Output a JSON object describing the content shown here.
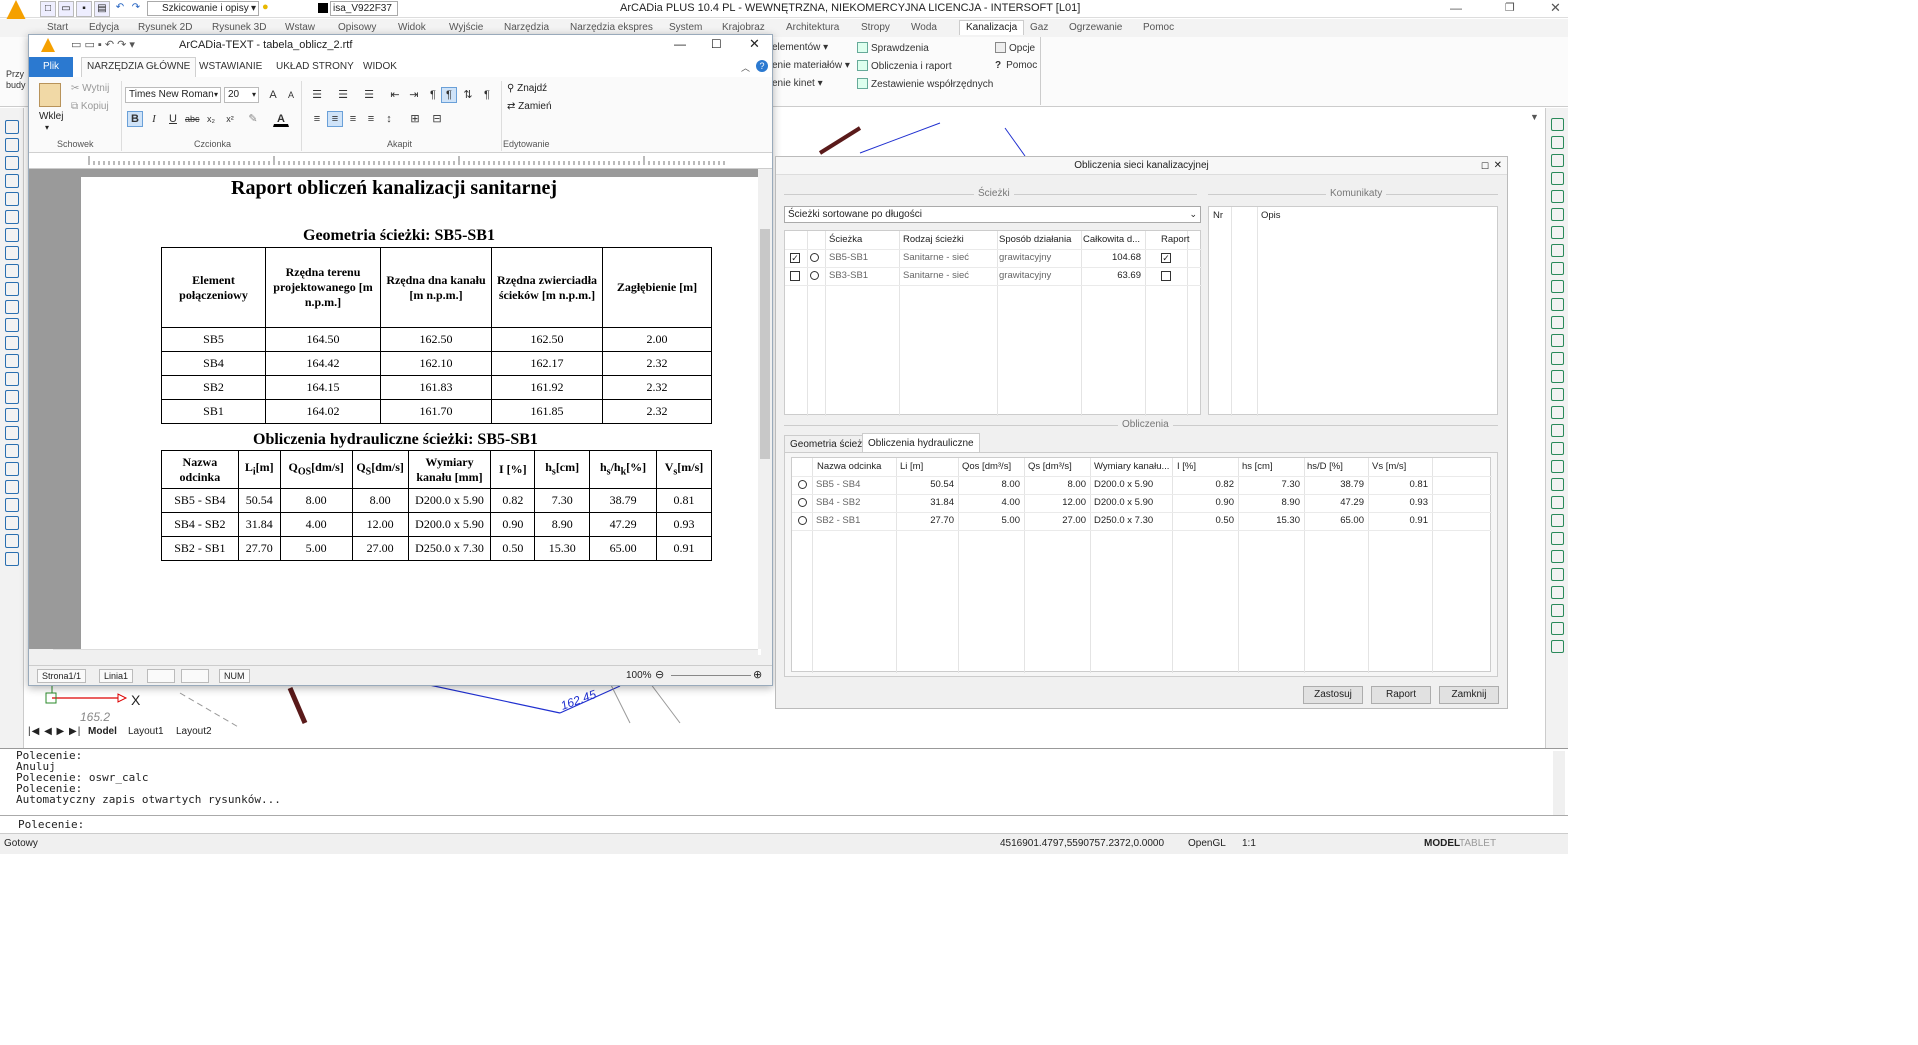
{
  "app": {
    "title": "ArCADia PLUS 10.4 PL - WEWNĘTRZNA, NIEKOMERCYJNA LICENCJA - INTERSOFT [L01]",
    "workspace": "Szkicowanie i opisy",
    "layer": "isa_V922F37"
  },
  "ribbon_tabs": [
    "Start",
    "Edycja",
    "Rysunek 2D",
    "Rysunek 3D",
    "Wstaw",
    "Opisowy",
    "Widok",
    "Wyjście",
    "Narzędzia",
    "Narzędzia ekspres",
    "System",
    "Krajobraz",
    "Architektura",
    "Stropy",
    "Woda",
    "Kanalizacja",
    "Gaz",
    "Ogrzewanie",
    "Pomoc"
  ],
  "ribbon_active": "Kanalizacja",
  "ribbon_left": {
    "big": "Przy budy"
  },
  "ribbon_items": {
    "elementow": "elementów",
    "materialow": "enie materiałów",
    "kinet": "enie kinet",
    "sprawdzenia": "Sprawdzenia",
    "obliczenia": "Obliczenia i raport",
    "zestawienie": "Zestawienie współrzędnych",
    "opcje": "Opcje",
    "pomoc": "Pomoc"
  },
  "editor": {
    "title": "ArCADia-TEXT - tabela_oblicz_2.rtf",
    "tabs": [
      "Plik",
      "NARZĘDZIA GŁÓWNE",
      "WSTAWIANIE",
      "UKŁAD STRONY",
      "WIDOK"
    ],
    "clipboard": {
      "paste": "Wklej",
      "cut": "Wytnij",
      "copy": "Kopiuj",
      "group": "Schowek"
    },
    "font": {
      "name": "Times New Roman",
      "size": "20",
      "group": "Czcionka"
    },
    "paragraph_group": "Akapit",
    "editing": {
      "find": "Znajdź",
      "replace": "Zamień",
      "group": "Edytowanie"
    },
    "status": {
      "page": "Strona1/1",
      "line": "Linia1",
      "num": "NUM",
      "zoom": "100%"
    }
  },
  "document": {
    "title": "Raport obliczeń kanalizacji sanitarnej",
    "geometry_title": "Geometria ścieżki: SB5-SB1",
    "geometry_headers": [
      "Element połączeniowy",
      "Rzędna terenu projektowanego [m n.p.m.]",
      "Rzędna dna kanału [m n.p.m.]",
      "Rzędna zwierciadła ścieków [m n.p.m.]",
      "Zagłębienie [m]"
    ],
    "geometry_rows": [
      [
        "SB5",
        "164.50",
        "162.50",
        "162.50",
        "2.00"
      ],
      [
        "SB4",
        "164.42",
        "162.10",
        "162.17",
        "2.32"
      ],
      [
        "SB2",
        "164.15",
        "161.83",
        "161.92",
        "2.32"
      ],
      [
        "SB1",
        "164.02",
        "161.70",
        "161.85",
        "2.32"
      ]
    ],
    "hydraulic_title": "Obliczenia hydrauliczne ścieżki: SB5-SB1",
    "hydraulic_headers": {
      "name": "Nazwa odcinka",
      "li": "L",
      "li_sub": "i",
      "li_unit": "[m]",
      "qos": "Q",
      "qos_sub": "OS",
      "qos_unit": "[dm/s]",
      "qs": "Q",
      "qs_sub": "S",
      "qs_unit": "[dm/s]",
      "dim": "Wymiary kanału [mm]",
      "i": "I [%]",
      "hs": "h",
      "hs_sub": "s",
      "hs_unit": "[cm]",
      "hshk": "h",
      "hshk_sub1": "s",
      "hshk_mid": "/h",
      "hshk_sub2": "k",
      "hshk_unit": "[%]",
      "vs": "V",
      "vs_sub": "s",
      "vs_unit": "[m/s]"
    },
    "hydraulic_rows": [
      [
        "SB5 - SB4",
        "50.54",
        "8.00",
        "8.00",
        "D200.0 x 5.90",
        "0.82",
        "7.30",
        "38.79",
        "0.81"
      ],
      [
        "SB4 - SB2",
        "31.84",
        "4.00",
        "12.00",
        "D200.0 x 5.90",
        "0.90",
        "8.90",
        "47.29",
        "0.93"
      ],
      [
        "SB2 - SB1",
        "27.70",
        "5.00",
        "27.00",
        "D250.0 x 7.30",
        "0.50",
        "15.30",
        "65.00",
        "0.91"
      ]
    ]
  },
  "dialog": {
    "title": "Obliczenia sieci kanalizacyjnej",
    "paths_section": "Ścieżki",
    "messages_section": "Komunikaty",
    "sort": "Ścieżki sortowane po długości",
    "paths_headers": [
      "Ścieżka",
      "Rodzaj ścieżki",
      "Sposób działania",
      "Całkowita d...",
      "Raport"
    ],
    "paths": [
      {
        "checked": true,
        "name": "SB5-SB1",
        "type": "Sanitarne - sieć",
        "mode": "grawitacyjny",
        "length": "104.68",
        "report": true
      },
      {
        "checked": false,
        "name": "SB3-SB1",
        "type": "Sanitarne - sieć",
        "mode": "grawitacyjny",
        "length": "63.69",
        "report": false
      }
    ],
    "messages_headers": [
      "Nr",
      "Opis"
    ],
    "calc_section": "Obliczenia",
    "calc_tabs": [
      "Geometria ścieżki",
      "Obliczenia hydrauliczne"
    ],
    "calc_headers": [
      "Nazwa odcinka",
      "Li [m]",
      "Qos [dm³/s]",
      "Qs [dm³/s]",
      "Wymiary kanału...",
      "I [%]",
      "hs [cm]",
      "hs/D [%]",
      "Vs [m/s]"
    ],
    "calc_rows": [
      [
        "SB5 - SB4",
        "50.54",
        "8.00",
        "8.00",
        "D200.0 x 5.90",
        "0.82",
        "7.30",
        "38.79",
        "0.81"
      ],
      [
        "SB4 - SB2",
        "31.84",
        "4.00",
        "12.00",
        "D200.0 x 5.90",
        "0.90",
        "8.90",
        "47.29",
        "0.93"
      ],
      [
        "SB2 - SB1",
        "27.70",
        "5.00",
        "27.00",
        "D250.0 x 7.30",
        "0.50",
        "15.30",
        "65.00",
        "0.91"
      ]
    ],
    "buttons": {
      "apply": "Zastosuj",
      "report": "Raport",
      "close": "Zamknij"
    }
  },
  "drawing": {
    "labels": {
      "a": "165.2",
      "b": "162.45"
    },
    "tabs": [
      "Model",
      "Layout1",
      "Layout2"
    ]
  },
  "command": {
    "lines": [
      "Polecenie:",
      "Anuluj",
      "Polecenie: oswr_calc",
      "Polecenie:",
      "Automatyczny zapis otwartych rysunków..."
    ],
    "prompt": "Polecenie:"
  },
  "statusbar": {
    "ready": "Gotowy",
    "coords": "4516901.4797,5590757.2372,0.0000",
    "render": "OpenGL",
    "scale": "1:1",
    "mode": "MODEL",
    "tablet": "TABLET"
  }
}
